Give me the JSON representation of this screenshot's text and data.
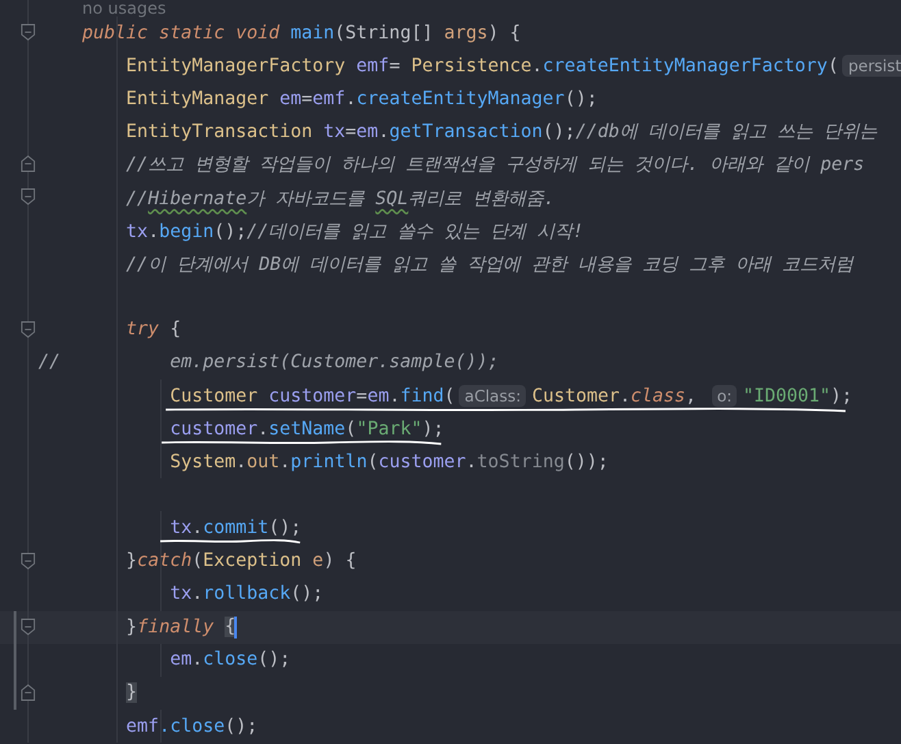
{
  "usage_hint": "no usages",
  "lines": [
    {
      "fold_start": true,
      "tokens": [
        {
          "t": "    public static void ",
          "kind": "keyword"
        },
        {
          "t": "main",
          "kind": "method"
        },
        {
          "t": "(String[] ",
          "kind": "plain"
        },
        {
          "t": "args",
          "kind": "param"
        },
        {
          "t": ") {",
          "kind": "plain"
        }
      ]
    },
    {
      "tokens": [
        {
          "t": "        EntityManagerFactory ",
          "kind": "type"
        },
        {
          "t": "emf",
          "kind": "var"
        },
        {
          "t": "= ",
          "kind": "plain"
        },
        {
          "t": "Persistence",
          "kind": "type"
        },
        {
          "t": ".",
          "kind": "plain"
        },
        {
          "t": "createEntityManagerFactory",
          "kind": "method"
        },
        {
          "t": "(",
          "kind": "plain"
        },
        {
          "t": "persist",
          "kind": "hint"
        }
      ]
    },
    {
      "tokens": [
        {
          "t": "        EntityManager ",
          "kind": "type"
        },
        {
          "t": "em",
          "kind": "var"
        },
        {
          "t": "=",
          "kind": "plain"
        },
        {
          "t": "emf",
          "kind": "var"
        },
        {
          "t": ".",
          "kind": "plain"
        },
        {
          "t": "createEntityManager",
          "kind": "method"
        },
        {
          "t": "();",
          "kind": "plain"
        }
      ]
    },
    {
      "tokens": [
        {
          "t": "        EntityTransaction ",
          "kind": "type"
        },
        {
          "t": "tx",
          "kind": "var"
        },
        {
          "t": "=",
          "kind": "plain"
        },
        {
          "t": "em",
          "kind": "var"
        },
        {
          "t": ".",
          "kind": "plain"
        },
        {
          "t": "getTransaction",
          "kind": "method"
        },
        {
          "t": "();",
          "kind": "plain"
        },
        {
          "t": "//db에 데이터를 읽고 쓰는 단위는",
          "kind": "comment"
        }
      ]
    },
    {
      "fold_end": true,
      "tokens": [
        {
          "t": "        //쓰고 변형할 작업들이 하나의 트랜잭션을 구성하게 되는 것이다. 아래와 같이 pers",
          "kind": "comment"
        }
      ]
    },
    {
      "fold_start": true,
      "tokens": [
        {
          "t": "        //",
          "kind": "comment"
        },
        {
          "t": "Hibernate",
          "kind": "comment",
          "typo": true
        },
        {
          "t": "가 자바코드를 ",
          "kind": "comment"
        },
        {
          "t": "SQL",
          "kind": "comment",
          "typo": true
        },
        {
          "t": "쿼리로 변환해줌.",
          "kind": "comment"
        }
      ]
    },
    {
      "tokens": [
        {
          "t": "        tx",
          "kind": "var"
        },
        {
          "t": ".",
          "kind": "plain"
        },
        {
          "t": "begin",
          "kind": "method"
        },
        {
          "t": "();",
          "kind": "plain"
        },
        {
          "t": "//데이터를 읽고 쓸수 있는 단계 시작!",
          "kind": "comment"
        }
      ]
    },
    {
      "tokens": [
        {
          "t": "        //이 단계에서 DB에 데이터를 읽고 쓸 작업에 관한 내용을 코딩 그후 아래 코드처럼",
          "kind": "comment"
        }
      ]
    },
    {
      "gap_before": true,
      "fold_start": true,
      "tokens": [
        {
          "t": "        try",
          "kind": "keyword"
        },
        {
          "t": " {",
          "kind": "plain"
        }
      ]
    },
    {
      "tokens": [
        {
          "t": "//          em.persist(Customer.sample());",
          "kind": "comment"
        }
      ]
    },
    {
      "underlined": true,
      "tokens": [
        {
          "t": "            Customer ",
          "kind": "type"
        },
        {
          "t": "customer",
          "kind": "var"
        },
        {
          "t": "=",
          "kind": "plain"
        },
        {
          "t": "em",
          "kind": "var"
        },
        {
          "t": ".",
          "kind": "plain"
        },
        {
          "t": "find",
          "kind": "method"
        },
        {
          "t": "(",
          "kind": "plain"
        },
        {
          "t": "aClass:",
          "kind": "hint"
        },
        {
          "t": "Customer",
          "kind": "type"
        },
        {
          "t": ".",
          "kind": "plain"
        },
        {
          "t": "class",
          "kind": "keyword"
        },
        {
          "t": ", ",
          "kind": "plain"
        },
        {
          "t": "o:",
          "kind": "hint"
        },
        {
          "t": "\"ID0001\"",
          "kind": "string"
        },
        {
          "t": ");",
          "kind": "plain"
        }
      ]
    },
    {
      "underlined": true,
      "tokens": [
        {
          "t": "            customer",
          "kind": "var"
        },
        {
          "t": ".",
          "kind": "plain"
        },
        {
          "t": "setName",
          "kind": "method"
        },
        {
          "t": "(",
          "kind": "plain"
        },
        {
          "t": "\"Park\"",
          "kind": "string"
        },
        {
          "t": ");",
          "kind": "plain"
        }
      ]
    },
    {
      "tokens": [
        {
          "t": "            System",
          "kind": "type"
        },
        {
          "t": ".",
          "kind": "plain"
        },
        {
          "t": "out",
          "kind": "field"
        },
        {
          "t": ".",
          "kind": "plain"
        },
        {
          "t": "println",
          "kind": "method"
        },
        {
          "t": "(",
          "kind": "plain"
        },
        {
          "t": "customer",
          "kind": "var"
        },
        {
          "t": ".",
          "kind": "plain"
        },
        {
          "t": "toString",
          "kind": "dim"
        },
        {
          "t": "());",
          "kind": "plain"
        }
      ]
    },
    {
      "gap_before": true,
      "underlined": true,
      "tokens": [
        {
          "t": "            tx",
          "kind": "var"
        },
        {
          "t": ".",
          "kind": "plain"
        },
        {
          "t": "commit",
          "kind": "method"
        },
        {
          "t": "();",
          "kind": "plain"
        }
      ]
    },
    {
      "fold_start": true,
      "tokens": [
        {
          "t": "        }",
          "kind": "plain"
        },
        {
          "t": "catch",
          "kind": "keyword"
        },
        {
          "t": "(",
          "kind": "plain"
        },
        {
          "t": "Exception ",
          "kind": "type"
        },
        {
          "t": "e",
          "kind": "param"
        },
        {
          "t": ") {",
          "kind": "plain"
        }
      ]
    },
    {
      "tokens": [
        {
          "t": "            tx",
          "kind": "var"
        },
        {
          "t": ".",
          "kind": "plain"
        },
        {
          "t": "rollback",
          "kind": "method"
        },
        {
          "t": "();",
          "kind": "plain"
        }
      ]
    },
    {
      "fold_start": true,
      "current": true,
      "changed": true,
      "tokens": [
        {
          "t": "        }",
          "kind": "plain"
        },
        {
          "t": "finally ",
          "kind": "keyword"
        },
        {
          "t": "{",
          "kind": "plain",
          "matched": true,
          "caret": true
        }
      ]
    },
    {
      "changed": true,
      "tokens": [
        {
          "t": "            em",
          "kind": "var"
        },
        {
          "t": ".",
          "kind": "plain"
        },
        {
          "t": "close",
          "kind": "method"
        },
        {
          "t": "();",
          "kind": "plain"
        }
      ]
    },
    {
      "fold_end": true,
      "changed": true,
      "tokens": [
        {
          "t": "        }",
          "kind": "plain",
          "matched": true
        }
      ]
    },
    {
      "tokens": [
        {
          "t": "        emf",
          "kind": "var"
        },
        {
          "t": ".close",
          "kind": "method"
        },
        {
          "t": "();",
          "kind": "plain"
        }
      ]
    }
  ]
}
